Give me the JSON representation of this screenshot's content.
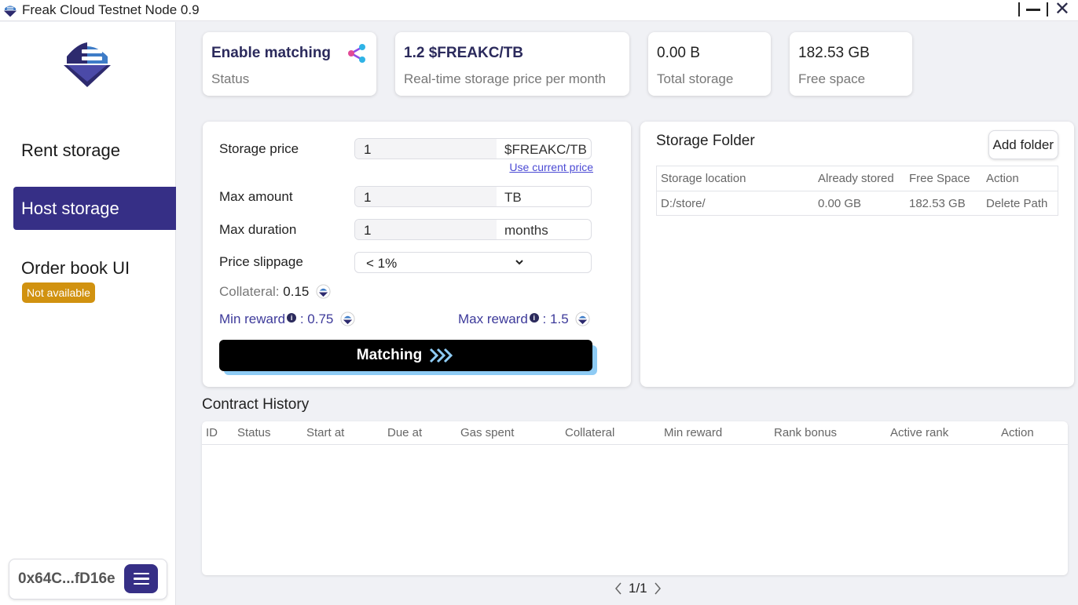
{
  "window": {
    "title": "Freak Cloud Testnet Node 0.9"
  },
  "sidebar": {
    "items": [
      {
        "label": "Rent storage"
      },
      {
        "label": "Host storage",
        "active": true
      },
      {
        "label": "Order book UI",
        "badge": "Not available"
      }
    ],
    "wallet": {
      "address": "0x64C...fD16e"
    }
  },
  "stats": [
    {
      "value": "Enable matching",
      "label": "Status",
      "icon": "share-icon"
    },
    {
      "value": "1.2 $FREAKC/TB",
      "label": "Real-time storage price per month"
    },
    {
      "value": "0.00 B",
      "label": "Total storage"
    },
    {
      "value": "182.53 GB",
      "label": "Free space"
    }
  ],
  "form": {
    "storage_price": {
      "label": "Storage price",
      "value": "1",
      "unit": "$FREAKC/TB",
      "link": "Use current price"
    },
    "max_amount": {
      "label": "Max amount",
      "value": "1",
      "unit": "TB"
    },
    "max_duration": {
      "label": "Max duration",
      "value": "1",
      "unit": "months"
    },
    "price_slippage": {
      "label": "Price slippage",
      "value": "< 1%"
    },
    "collateral": {
      "label": "Collateral:",
      "value": "0.15"
    },
    "min_reward": {
      "label": "Min reward",
      "value": "0.75"
    },
    "max_reward": {
      "label": "Max reward",
      "value": "1.5"
    },
    "reward_separator": ":",
    "info_mark": "i",
    "matching_button": "Matching"
  },
  "storage_folder": {
    "title": "Storage Folder",
    "add_button": "Add folder",
    "columns": [
      "Storage location",
      "Already stored",
      "Free Space",
      "Action"
    ],
    "rows": [
      [
        "D:/store/",
        "0.00 GB",
        "182.53 GB",
        "Delete Path"
      ]
    ]
  },
  "contract_history": {
    "title": "Contract History",
    "columns": [
      "ID",
      "Status",
      "Start at",
      "Due at",
      "Gas spent",
      "Collateral",
      "Min reward",
      "Rank bonus",
      "Active rank",
      "Action"
    ],
    "pagination": "1/1"
  },
  "colors": {
    "accent": "#362f86",
    "badge": "#d19210",
    "button": "#000000",
    "button_shadow": "#8ecbf4",
    "link": "#4b4ad4"
  }
}
